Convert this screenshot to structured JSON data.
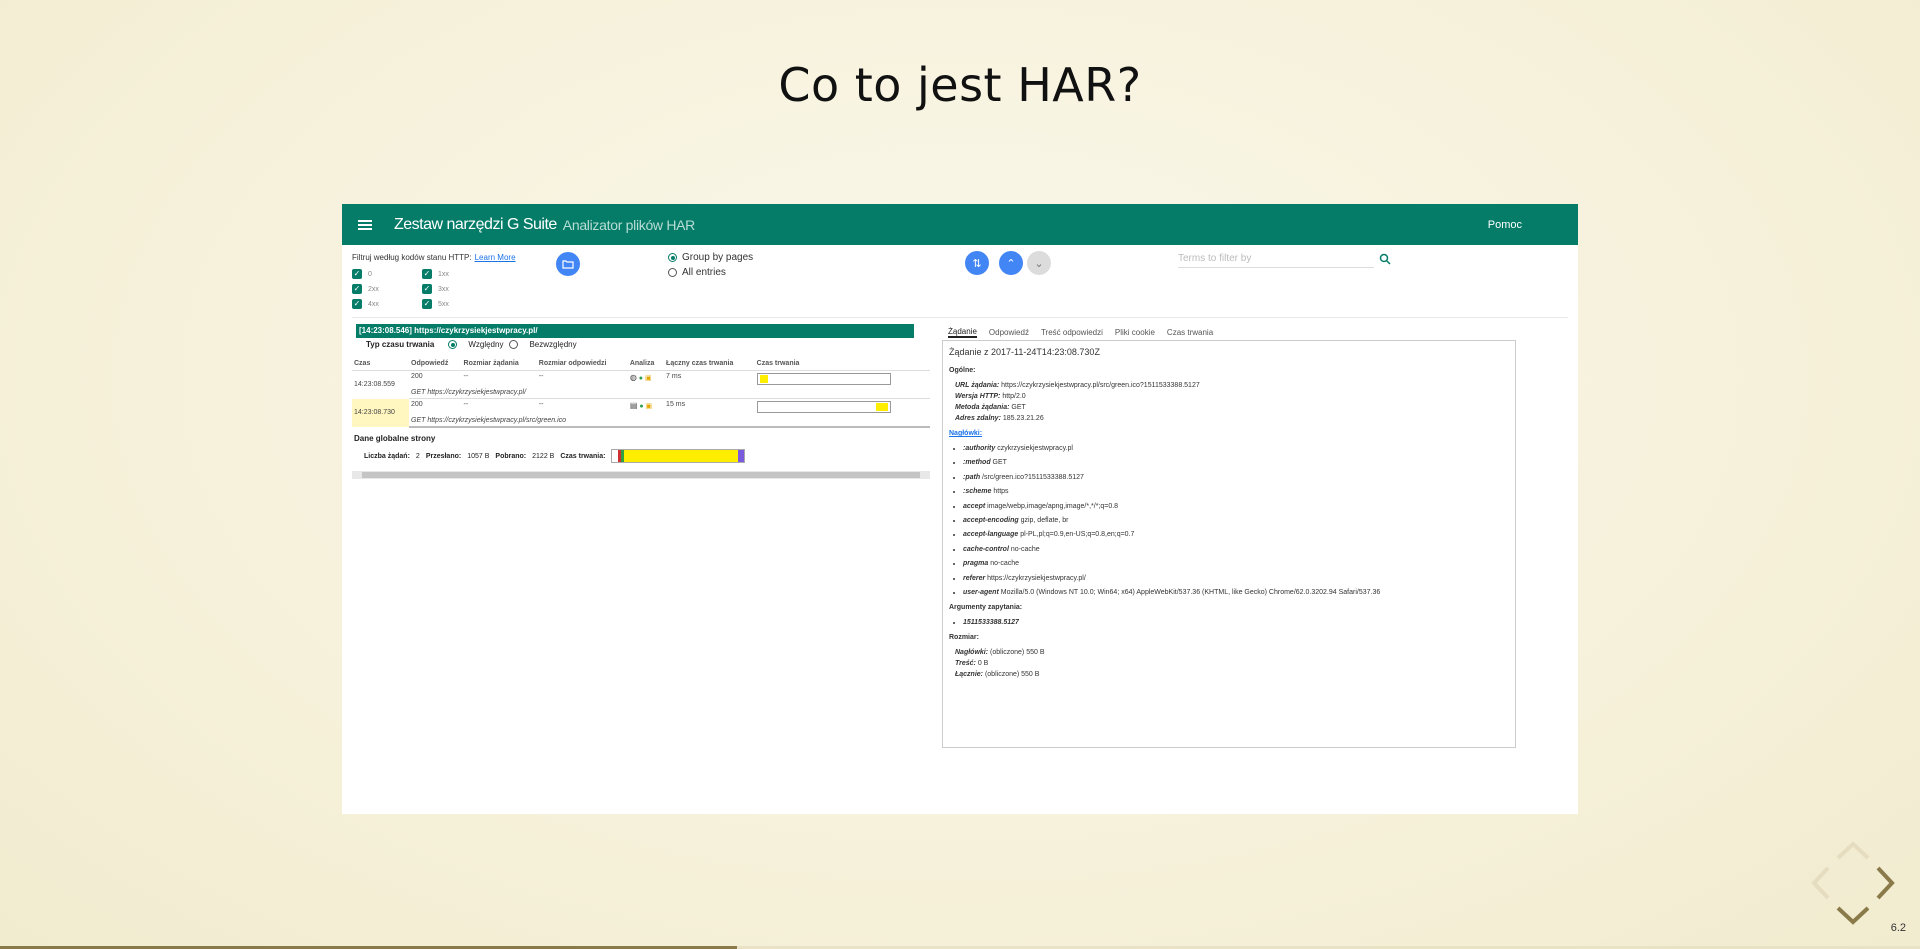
{
  "slide": {
    "title": "Co to jest HAR?",
    "number": "6.2",
    "progress_fraction": 0.384
  },
  "app": {
    "name": "Zestaw narzędzi G Suite",
    "subtitle": "Analizator plików HAR",
    "help": "Pomoc",
    "accent_color": "#047c68"
  },
  "filters": {
    "label": "Filtruj według kodów stanu HTTP:",
    "learn_more": "Learn More",
    "codes": [
      "0",
      "1xx",
      "2xx",
      "3xx",
      "4xx",
      "5xx"
    ]
  },
  "grouping": {
    "options": [
      "Group by pages",
      "All entries"
    ],
    "selected": "Group by pages"
  },
  "search": {
    "placeholder": "Terms to filter by"
  },
  "page": {
    "label": "[14:23:08.546] https://czykrzysiekjestwpracy.pl/"
  },
  "timing_type": {
    "label": "Typ czasu trwania",
    "options": [
      "Względny",
      "Bezwzględny"
    ],
    "selected": "Względny"
  },
  "table": {
    "columns": [
      "Czas",
      "Odpowiedź",
      "Rozmiar żądania",
      "Rozmiar odpowiedzi",
      "Analiza",
      "Łączny czas trwania",
      "Czas trwania"
    ],
    "rows": [
      {
        "time": "14:23:08.559",
        "status": "200",
        "req_size": "--",
        "resp_size": "--",
        "total": "7 ms",
        "url": "GET https://czykrzysiekjestwpracy.pl/",
        "bar_start": 0.02,
        "bar_width": 0.06
      },
      {
        "time": "14:23:08.730",
        "status": "200",
        "req_size": "--",
        "resp_size": "--",
        "total": "15 ms",
        "url": "GET https://czykrzysiekjestwpracy.pl/src/green.ico",
        "bar_start": 0.9,
        "bar_width": 0.09
      }
    ]
  },
  "globals": {
    "title": "Dane globalne strony",
    "count_label": "Liczba żądań:",
    "count": "2",
    "sent_label": "Przesłano:",
    "sent": "1057 B",
    "recv_label": "Pobrano:",
    "recv": "2122 B",
    "duration_label": "Czas trwania:"
  },
  "detail": {
    "tabs": [
      "Żądanie",
      "Odpowiedź",
      "Treść odpowiedzi",
      "Pliki cookie",
      "Czas trwania"
    ],
    "active_tab": "Żądanie",
    "header": "Żądanie z 2017-11-24T14:23:08.730Z",
    "general_title": "Ogólne:",
    "general": [
      {
        "k": "URL żądania:",
        "v": "https://czykrzysiekjestwpracy.pl/src/green.ico?1511533388.5127"
      },
      {
        "k": "Wersja HTTP:",
        "v": "http/2.0"
      },
      {
        "k": "Metoda żądania:",
        "v": "GET"
      },
      {
        "k": "Adres zdalny:",
        "v": "185.23.21.26"
      }
    ],
    "headers_title": "Nagłówki:",
    "headers": [
      {
        "k": ":authority",
        "v": "czykrzysiekjestwpracy.pl"
      },
      {
        "k": ":method",
        "v": "GET"
      },
      {
        "k": ":path",
        "v": "/src/green.ico?1511533388.5127"
      },
      {
        "k": ":scheme",
        "v": "https"
      },
      {
        "k": "accept",
        "v": "image/webp,image/apng,image/*,*/*;q=0.8"
      },
      {
        "k": "accept-encoding",
        "v": "gzip, deflate, br"
      },
      {
        "k": "accept-language",
        "v": "pl-PL,pl;q=0.9,en-US;q=0.8,en;q=0.7"
      },
      {
        "k": "cache-control",
        "v": "no-cache"
      },
      {
        "k": "pragma",
        "v": "no-cache"
      },
      {
        "k": "referer",
        "v": "https://czykrzysiekjestwpracy.pl/"
      },
      {
        "k": "user-agent",
        "v": "Mozilla/5.0 (Windows NT 10.0; Win64; x64) AppleWebKit/537.36 (KHTML, like Gecko) Chrome/62.0.3202.94 Safari/537.36"
      }
    ],
    "query_title": "Argumenty zapytania:",
    "query": [
      "1511533388.5127"
    ],
    "size_title": "Rozmiar:",
    "sizes": [
      {
        "k": "Nagłówki:",
        "v": "(obliczone)  550 B"
      },
      {
        "k": "Treść:",
        "v": "0 B"
      },
      {
        "k": "Łącznie:",
        "v": "(obliczone)  550 B"
      }
    ]
  }
}
